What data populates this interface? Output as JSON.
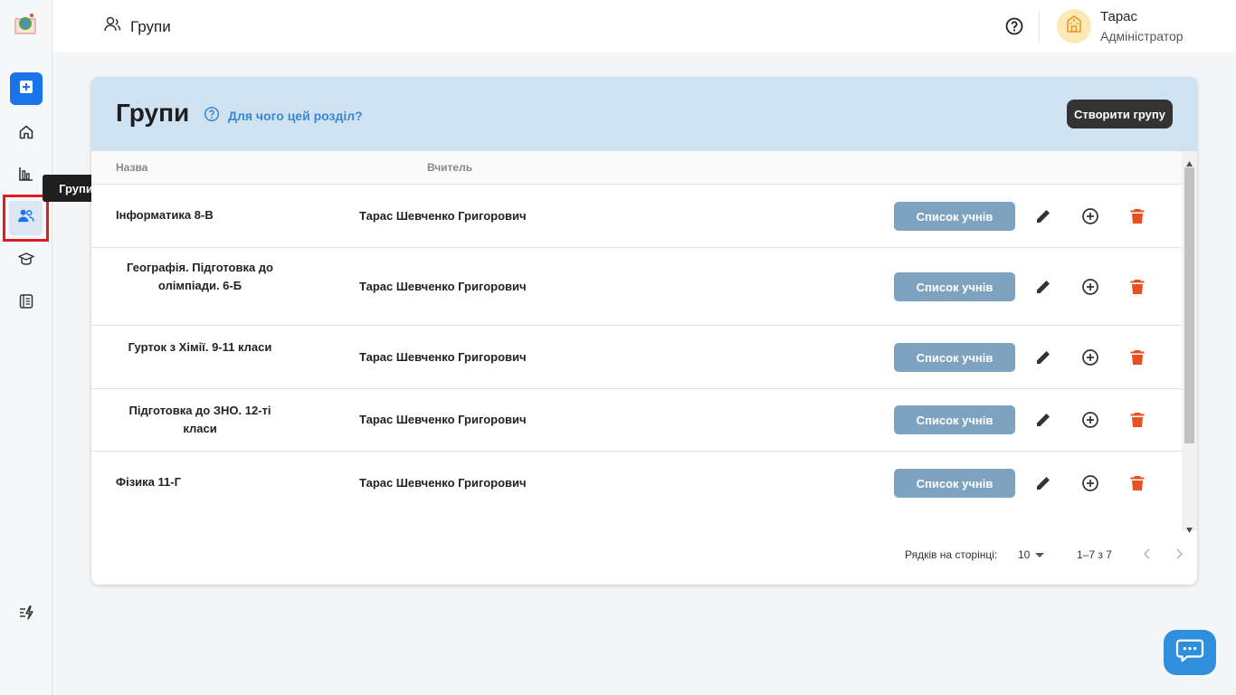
{
  "sidebar": {
    "tooltip": "Групи",
    "items": [
      {
        "icon": "plus-square-icon"
      },
      {
        "icon": "home-icon"
      },
      {
        "icon": "chart-icon"
      },
      {
        "icon": "users-icon"
      },
      {
        "icon": "graduation-cap-icon"
      },
      {
        "icon": "book-icon"
      },
      {
        "icon": "flash-icon"
      }
    ]
  },
  "header": {
    "title": "Групи",
    "user": {
      "name": "Тарас",
      "role": "Адміністратор"
    }
  },
  "main": {
    "title": "Групи",
    "help_link": "Для чого цей розділ?",
    "create_button": "Створити групу",
    "columns": [
      "Назва",
      "Вчитель"
    ],
    "rows": [
      {
        "name": "Інформатика 8-В",
        "teacher": "Тарас Шевченко Григорович",
        "action": "Список учнів"
      },
      {
        "name": "Географія. Підготовка до олімпіади. 6-Б",
        "teacher": "Тарас Шевченко Григорович",
        "action": "Список учнів"
      },
      {
        "name": "Гурток з Хімії. 9-11 класи",
        "teacher": "Тарас Шевченко Григорович",
        "action": "Список учнів"
      },
      {
        "name": "Підготовка до ЗНО. 12-ті класи",
        "teacher": "Тарас Шевченко Григорович",
        "action": "Список учнів"
      },
      {
        "name": "Фізика 11-Г",
        "teacher": "Тарас Шевченко Григорович",
        "action": "Список учнів"
      }
    ],
    "pagination": {
      "rows_label": "Рядків на сторінці:",
      "rows_value": "10",
      "range": "1–7 з 7"
    }
  },
  "colors": {
    "accent": "#1a73e8",
    "header_bg": "#cfe2f1",
    "list_button": "#7ea3c0",
    "delete": "#e8501f"
  }
}
